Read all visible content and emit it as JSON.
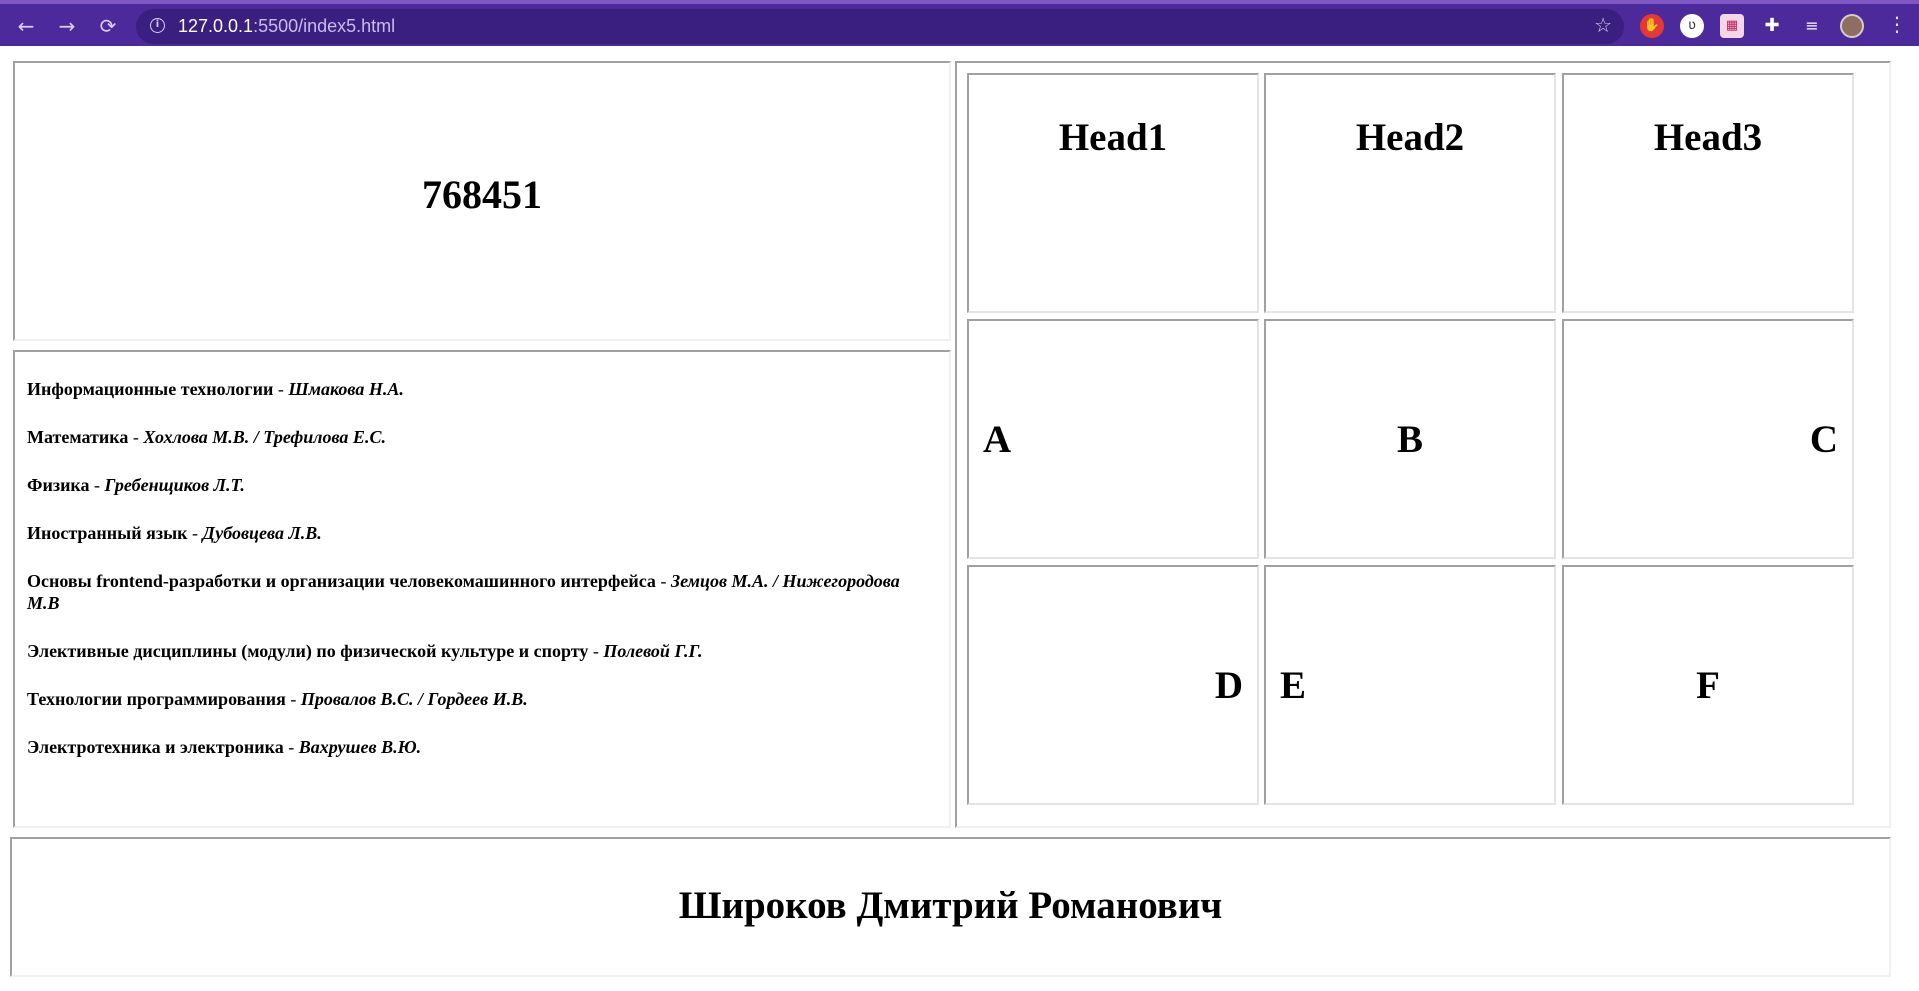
{
  "browser": {
    "url_host": "127.0.0.1",
    "url_rest": ":5500/index5.html",
    "nav": {
      "back_icon": "←",
      "forward_icon": "→",
      "reload_icon": "⟳"
    },
    "colors": {
      "chrome": "#4d2a9c",
      "omnibox": "#3a1e80"
    }
  },
  "code_block": {
    "value": "768451"
  },
  "subjects": [
    {
      "name": "Информационные технологии",
      "sep": " - ",
      "teacher": "Шмакова Н.А."
    },
    {
      "name": "Математика",
      "sep": " - ",
      "teacher": "Хохлова М.В. / Трефилова Е.С."
    },
    {
      "name": "Физика",
      "sep": " - ",
      "teacher": "Гребенщиков Л.Т."
    },
    {
      "name": "Иностранный язык",
      "sep": " - ",
      "teacher": "Дубовцева Л.В."
    },
    {
      "name": "Основы frontend-разработки и организации человекомашинного интерфейса",
      "sep": " - ",
      "teacher": "Земцов М.А. / Нижегородова М.В"
    },
    {
      "name": "Элективные дисциплины (модули) по физической культуре и спорту",
      "sep": " - ",
      "teacher": "Полевой Г.Г."
    },
    {
      "name": "Технологии программирования",
      "sep": " - ",
      "teacher": "Провалов В.С. / Гордеев И.В."
    },
    {
      "name": "Электротехника и электроника",
      "sep": " - ",
      "teacher": "Вахрушев В.Ю."
    }
  ],
  "grid": {
    "headers": [
      "Head1",
      "Head2",
      "Head3"
    ],
    "row1": [
      "A",
      "B",
      "C"
    ],
    "row2": [
      "D",
      "E",
      "F"
    ]
  },
  "footer": {
    "name": "Широков Дмитрий Романович"
  }
}
